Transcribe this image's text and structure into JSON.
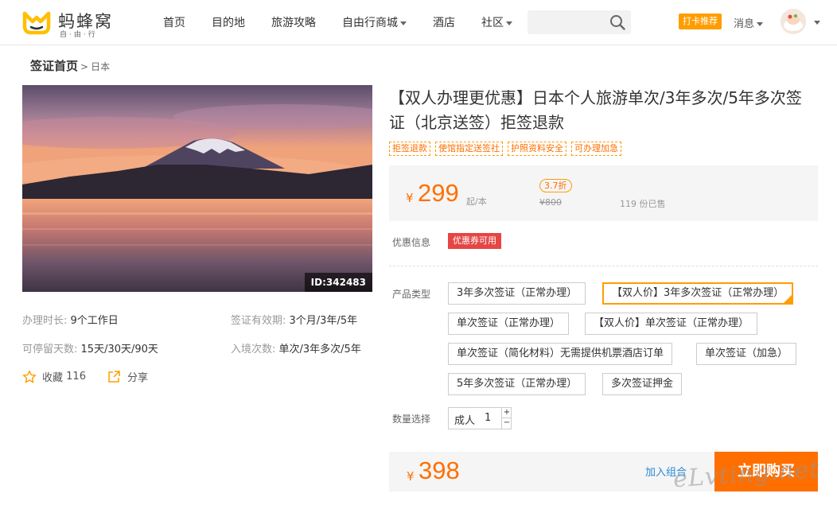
{
  "header": {
    "logo_text": "蚂蜂窝",
    "logo_sub": "自·由·行",
    "nav": [
      {
        "label": "首页",
        "dropdown": false
      },
      {
        "label": "目的地",
        "dropdown": false
      },
      {
        "label": "旅游攻略",
        "dropdown": false
      },
      {
        "label": "自由行商城",
        "dropdown": true
      },
      {
        "label": "酒店",
        "dropdown": false
      },
      {
        "label": "社区",
        "dropdown": true
      }
    ],
    "search_placeholder": "",
    "checkin_label": "打卡推荐",
    "message_label": "消息"
  },
  "breadcrumb": {
    "root": "签证首页",
    "separator": ">",
    "current": "日本"
  },
  "product": {
    "image_id": "ID:342483",
    "info": [
      {
        "label": "办理时长:",
        "value": "9个工作日"
      },
      {
        "label": "签证有效期:",
        "value": "3个月/3年/5年"
      },
      {
        "label": "可停留天数:",
        "value": "15天/30天/90天"
      },
      {
        "label": "入境次数:",
        "value": "单次/3年多次/5年"
      }
    ],
    "favorite_label": "收藏",
    "favorite_count": "116",
    "share_label": "分享",
    "title": "【双人办理更优惠】日本个人旅游单次/3年多次/5年多次签证（北京送签）拒签退款",
    "tags": [
      "拒签退款",
      "使馆指定送签社",
      "护照资料安全",
      "可办理加急"
    ],
    "currency_symbol": "¥",
    "price": "299",
    "price_unit": "起/本",
    "discount": "3.7折",
    "original_price": "¥800",
    "sold": "119 份已售",
    "coupon_label": "优惠信息",
    "coupon_badge": "优惠券可用",
    "type_label": "产品类型",
    "options": [
      {
        "label": "3年多次签证（正常办理）",
        "selected": false
      },
      {
        "label": "【双人价】3年多次签证（正常办理）",
        "selected": true
      },
      {
        "label": "单次签证（正常办理）",
        "selected": false
      },
      {
        "label": "【双人价】单次签证（正常办理）",
        "selected": false
      },
      {
        "label": "单次签证（简化材料）无需提供机票酒店订单",
        "selected": false
      },
      {
        "label": "单次签证（加急）",
        "selected": false
      },
      {
        "label": "5年多次签证（正常办理）",
        "selected": false
      },
      {
        "label": "多次签证押金",
        "selected": false
      }
    ],
    "quantity_label": "数量选择",
    "quantity_name": "成人",
    "quantity_value": "1",
    "total_price": "398",
    "combo_label": "加入组合",
    "buy_label": "立即购买",
    "watermark": "eLvting.net"
  },
  "colors": {
    "accent": "#ff6f00",
    "tag_border": "#ff9d00",
    "coupon": "#e64545",
    "link": "#2a8bd8"
  }
}
